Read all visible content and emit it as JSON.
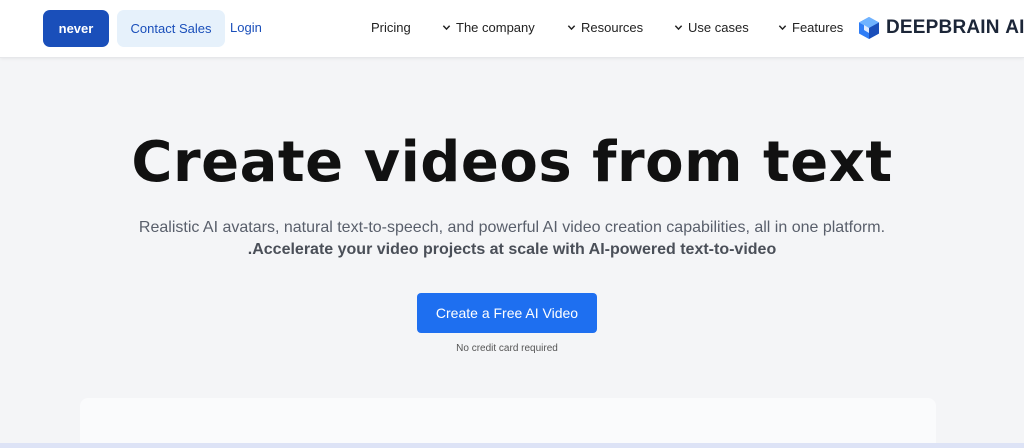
{
  "nav": {
    "primary_button": "never",
    "contact_button": "Contact Sales",
    "login": "Login",
    "items": [
      {
        "label": "Pricing",
        "dropdown": false
      },
      {
        "label": "The company",
        "dropdown": true
      },
      {
        "label": "Resources",
        "dropdown": true
      },
      {
        "label": "Use cases",
        "dropdown": true
      },
      {
        "label": "Features",
        "dropdown": true
      }
    ],
    "logo": {
      "name": "DEEPBRAIN",
      "suffix": "AI",
      "icon": "deepbrain-logo-icon"
    }
  },
  "hero": {
    "title": "Create videos from text",
    "subtitle": "Realistic AI avatars, natural text-to-speech, and powerful AI video creation capabilities, all in one platform.",
    "subtitle_bold": ".Accelerate your video projects at scale with AI-powered text-to-video",
    "cta": "Create a Free AI Video",
    "cta_note": "No credit card required"
  },
  "colors": {
    "brand_primary": "#1a4fba",
    "cta_blue": "#1e6ff0",
    "contact_bg": "#e6f1fb",
    "page_bg": "#f4f5f7"
  }
}
